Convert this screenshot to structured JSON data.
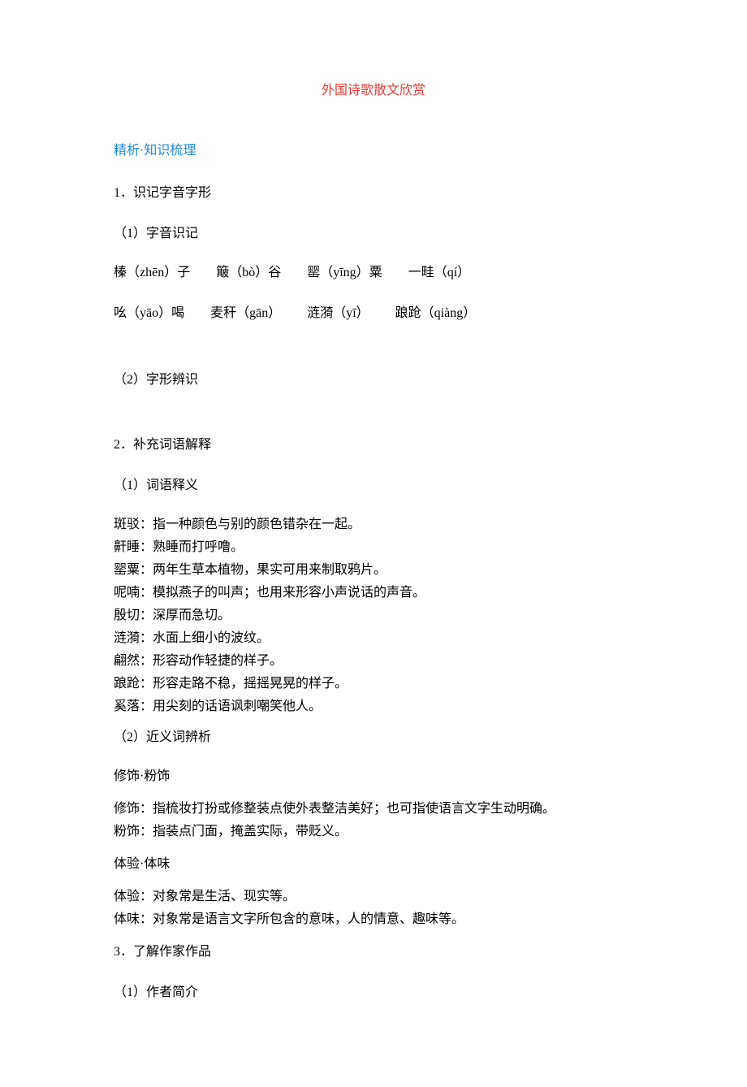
{
  "title": "外国诗歌散文欣赏",
  "sec_knowledge": "精析·知识梳理",
  "h1_phonetics": "1．识记字音字形",
  "h1_1_pronun": "（1）字音识记",
  "pinyin": {
    "line1": {
      "a": "榛（zhēn）子",
      "b": "簸（bò）谷",
      "c": "罂（yīng）粟",
      "d": "一畦（qí）"
    },
    "line2": {
      "a": "吆（yāo）喝",
      "b": "麦秆（gān）",
      "c": "涟漪（yī）",
      "d": "踉跄（qiàng）"
    }
  },
  "h1_2_glyph": "（2）字形辨识",
  "h2_vocab": "2．补充词语解释",
  "h2_1_meaning": "（1）词语释义",
  "vocab": [
    "斑驳：指一种颜色与别的颜色错杂在一起。",
    "鼾睡：熟睡而打呼噜。",
    "罂粟：两年生草本植物，果实可用来制取鸦片。",
    "呢喃：模拟燕子的叫声；也用来形容小声说话的声音。",
    "殷切：深厚而急切。",
    "涟漪：水面上细小的波纹。",
    "翩然：形容动作轻捷的样子。",
    "踉跄：形容走路不稳，摇摇晃晃的样子。",
    "奚落：用尖刻的话语讽刺嘲笑他人。"
  ],
  "h2_2_synonym": "（2）近义词辨析",
  "syn1": {
    "title": "修饰·粉饰",
    "a": "修饰：指梳妆打扮或修整装点使外表整洁美好；也可指使语言文字生动明确。",
    "b": "粉饰：指装点门面，掩盖实际，带贬义。"
  },
  "syn2": {
    "title": "体验·体味",
    "a": "体验：对象常是生活、现实等。",
    "b": "体味：对象常是语言文字所包含的意味，人的情意、趣味等。"
  },
  "h3_author": "3．了解作家作品",
  "h3_1_bio": "（1）作者简介"
}
